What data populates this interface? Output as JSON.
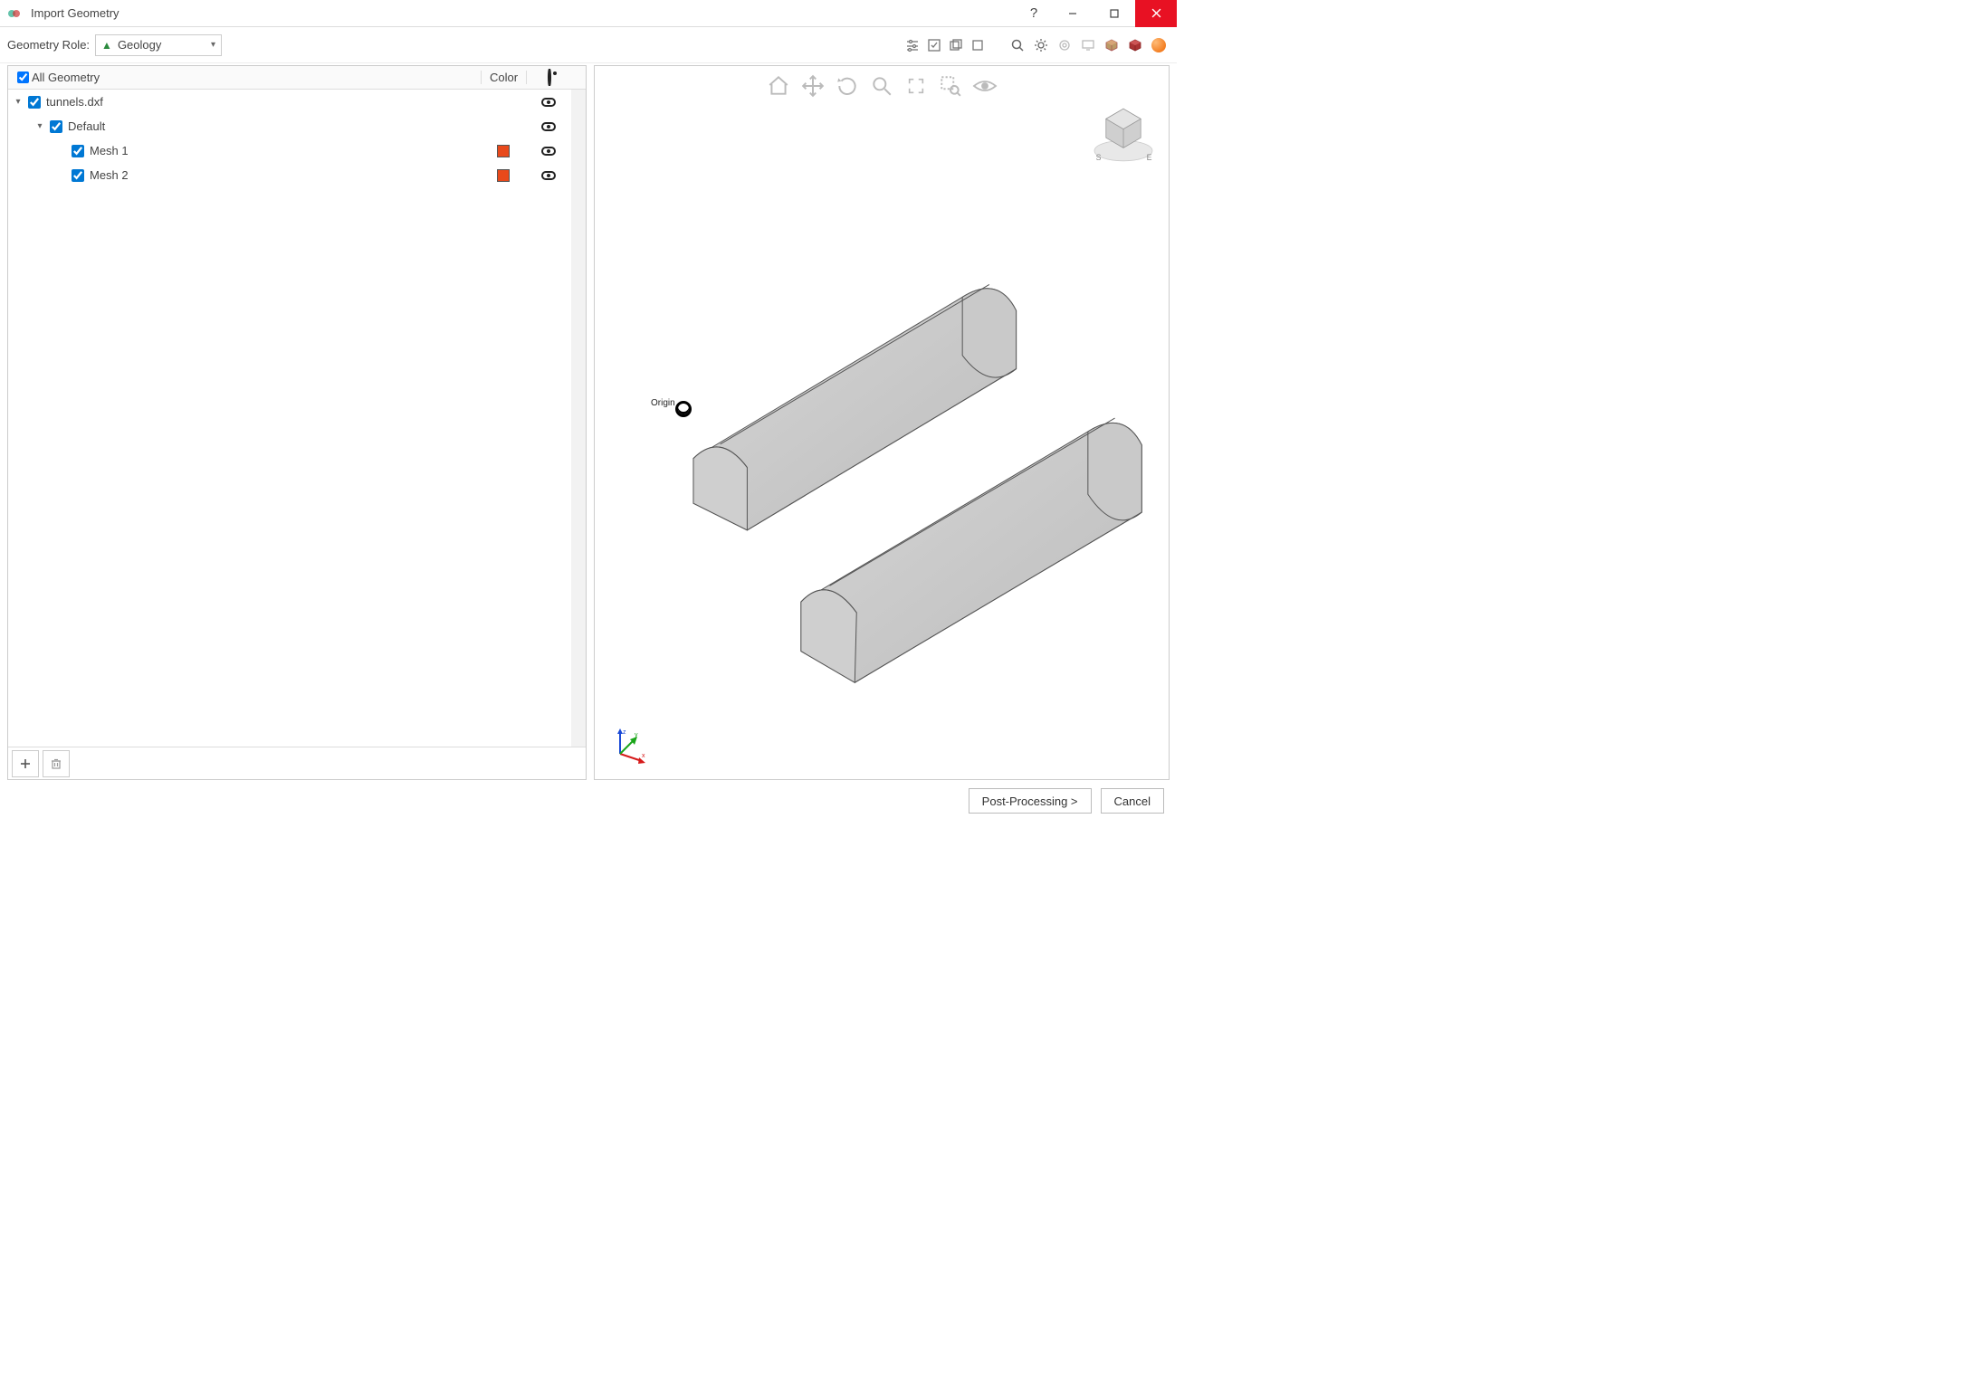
{
  "window": {
    "title": "Import Geometry"
  },
  "toolbar": {
    "role_label": "Geometry Role:",
    "role_value": "Geology"
  },
  "tree": {
    "header": {
      "all": "All Geometry",
      "color": "Color"
    },
    "file": "tunnels.dxf",
    "layer": "Default",
    "meshes": [
      {
        "name": "Mesh 1",
        "color": "#e8491b"
      },
      {
        "name": "Mesh 2",
        "color": "#e8491b"
      }
    ]
  },
  "viewport": {
    "origin_label": "Origin",
    "gizmo": {
      "s": "S",
      "e": "E"
    }
  },
  "footer": {
    "next": "Post-Processing >",
    "cancel": "Cancel"
  }
}
